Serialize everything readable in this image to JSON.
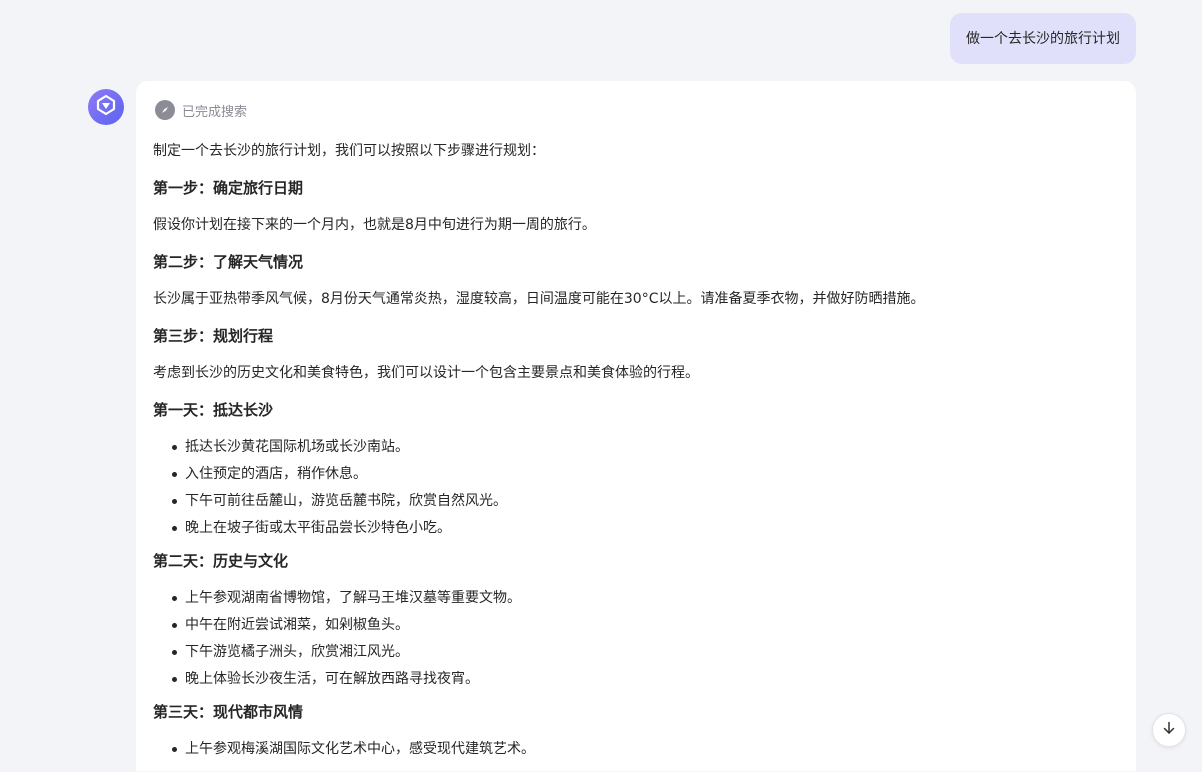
{
  "user_message": "做一个去长沙的旅行计划",
  "search_status": "已完成搜索",
  "icons": {
    "avatar": "assistant-logo-icon",
    "search_status": "compass-icon",
    "scroll_down": "arrow-down-icon"
  },
  "colors": {
    "user_bubble": "#e1e0fb",
    "avatar_gradient_start": "#8e7cf6",
    "avatar_gradient_end": "#5b66ea",
    "page_background": "#f3f4f8"
  },
  "answer": {
    "intro": "制定一个去长沙的旅行计划，我们可以按照以下步骤进行规划：",
    "step1_heading": "第一步：确定旅行日期",
    "step1_text": "假设你计划在接下来的一个月内，也就是8月中旬进行为期一周的旅行。",
    "step2_heading": "第二步：了解天气情况",
    "step2_text": "长沙属于亚热带季风气候，8月份天气通常炎热，湿度较高，日间温度可能在30°C以上。请准备夏季衣物，并做好防晒措施。",
    "step3_heading": "第三步：规划行程",
    "step3_text": "考虑到长沙的历史文化和美食特色，我们可以设计一个包含主要景点和美食体验的行程。",
    "day1_heading": "第一天：抵达长沙",
    "day1_items": [
      "抵达长沙黄花国际机场或长沙南站。",
      "入住预定的酒店，稍作休息。",
      "下午可前往岳麓山，游览岳麓书院，欣赏自然风光。",
      "晚上在坡子街或太平街品尝长沙特色小吃。"
    ],
    "day2_heading": "第二天：历史与文化",
    "day2_items": [
      "上午参观湖南省博物馆，了解马王堆汉墓等重要文物。",
      "中午在附近尝试湘菜，如剁椒鱼头。",
      "下午游览橘子洲头，欣赏湘江风光。",
      "晚上体验长沙夜生活，可在解放西路寻找夜宵。"
    ],
    "day3_heading": "第三天：现代都市风情",
    "day3_items": [
      "上午参观梅溪湖国际文化艺术中心，感受现代建筑艺术。"
    ]
  }
}
